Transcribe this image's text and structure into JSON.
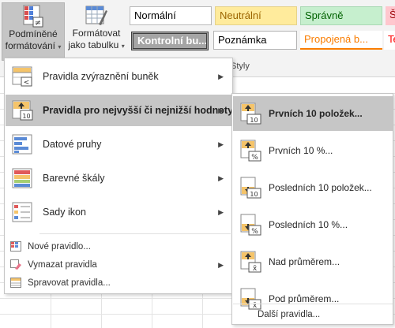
{
  "ribbon": {
    "conditional_formatting": {
      "line1": "Podmíněné",
      "line2": "formátování",
      "caret": "▾"
    },
    "format_as_table": {
      "line1": "Formátovat",
      "line2": "jako tabulku",
      "caret": "▾"
    },
    "styles": [
      {
        "label": "Normální",
        "bg": "#ffffff",
        "fg": "#000000"
      },
      {
        "label": "Neutrální",
        "bg": "#ffeb9c",
        "fg": "#9c6500"
      },
      {
        "label": "Správně",
        "bg": "#c6efce",
        "fg": "#006100"
      },
      {
        "label": "Šp",
        "bg": "#ffc7ce",
        "fg": "#9c0006"
      },
      {
        "label": "Kontrolní bu...",
        "bg": "#a5a5a5",
        "fg": "#ffffff"
      },
      {
        "label": "Poznámka",
        "bg": "#ffffff",
        "fg": "#000000"
      },
      {
        "label": "Propojená b...",
        "bg": "#ffffff",
        "fg": "#fa7d00"
      },
      {
        "label": "Te",
        "bg": "#ffffff",
        "fg": "#ff0000"
      }
    ],
    "styles_group_label": "Styly"
  },
  "menu": {
    "items": [
      {
        "label": "Pravidla zvýraznění buněk",
        "icon": "highlight-cells-rules-icon"
      },
      {
        "label": "Pravidla pro nejvyšší či nejnižší hodnoty",
        "icon": "top-bottom-rules-icon"
      },
      {
        "label": "Datové pruhy",
        "icon": "data-bars-icon"
      },
      {
        "label": "Barevné škály",
        "icon": "color-scales-icon"
      },
      {
        "label": "Sady ikon",
        "icon": "icon-sets-icon"
      }
    ],
    "small_items": [
      {
        "label": "Nové pravidlo...",
        "icon": "new-rule-icon"
      },
      {
        "label": "Vymazat pravidla",
        "icon": "clear-rules-icon"
      },
      {
        "label": "Spravovat pravidla...",
        "icon": "manage-rules-icon"
      }
    ]
  },
  "submenu": {
    "items": [
      {
        "label": "Prvních 10 položek...",
        "badge": "10"
      },
      {
        "label": "Prvních 10 %...",
        "badge": "%"
      },
      {
        "label": "Posledních 10 položek...",
        "badge": "10"
      },
      {
        "label": "Posledních 10 %...",
        "badge": "%"
      },
      {
        "label": "Nad průměrem...",
        "badge": "x̄"
      },
      {
        "label": "Pod průměrem...",
        "badge": "x̄"
      }
    ],
    "more_rules": "Další pravidla..."
  },
  "colors": {
    "highlight": "#c6c6c6",
    "ribbon_bg": "#f3f3f3",
    "rule_icon_yellow": "#f5c46a"
  }
}
